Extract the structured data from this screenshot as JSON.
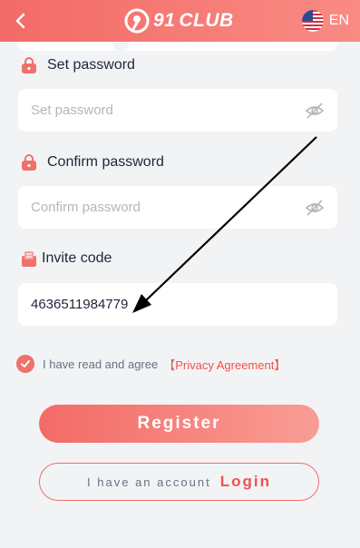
{
  "header": {
    "back_icon": "chevron-left-icon",
    "brand_number": "91",
    "brand_word": "CLUB",
    "language": "EN",
    "flag_icon": "us-flag-icon"
  },
  "form": {
    "set_password": {
      "label": "Set password",
      "placeholder": "Set password",
      "value": ""
    },
    "confirm_password": {
      "label": "Confirm password",
      "placeholder": "Confirm password",
      "value": ""
    },
    "invite_code": {
      "label": "Invite code",
      "value": "4636511984779"
    }
  },
  "agreement": {
    "checked": true,
    "text": "I have read and agree",
    "link": "【Privacy Agreement】"
  },
  "buttons": {
    "register": "Register",
    "login_hint": "I have an account",
    "login": "Login"
  },
  "colors": {
    "accent": "#f36a67",
    "link": "#f0524e",
    "background": "#f2f3f5"
  }
}
